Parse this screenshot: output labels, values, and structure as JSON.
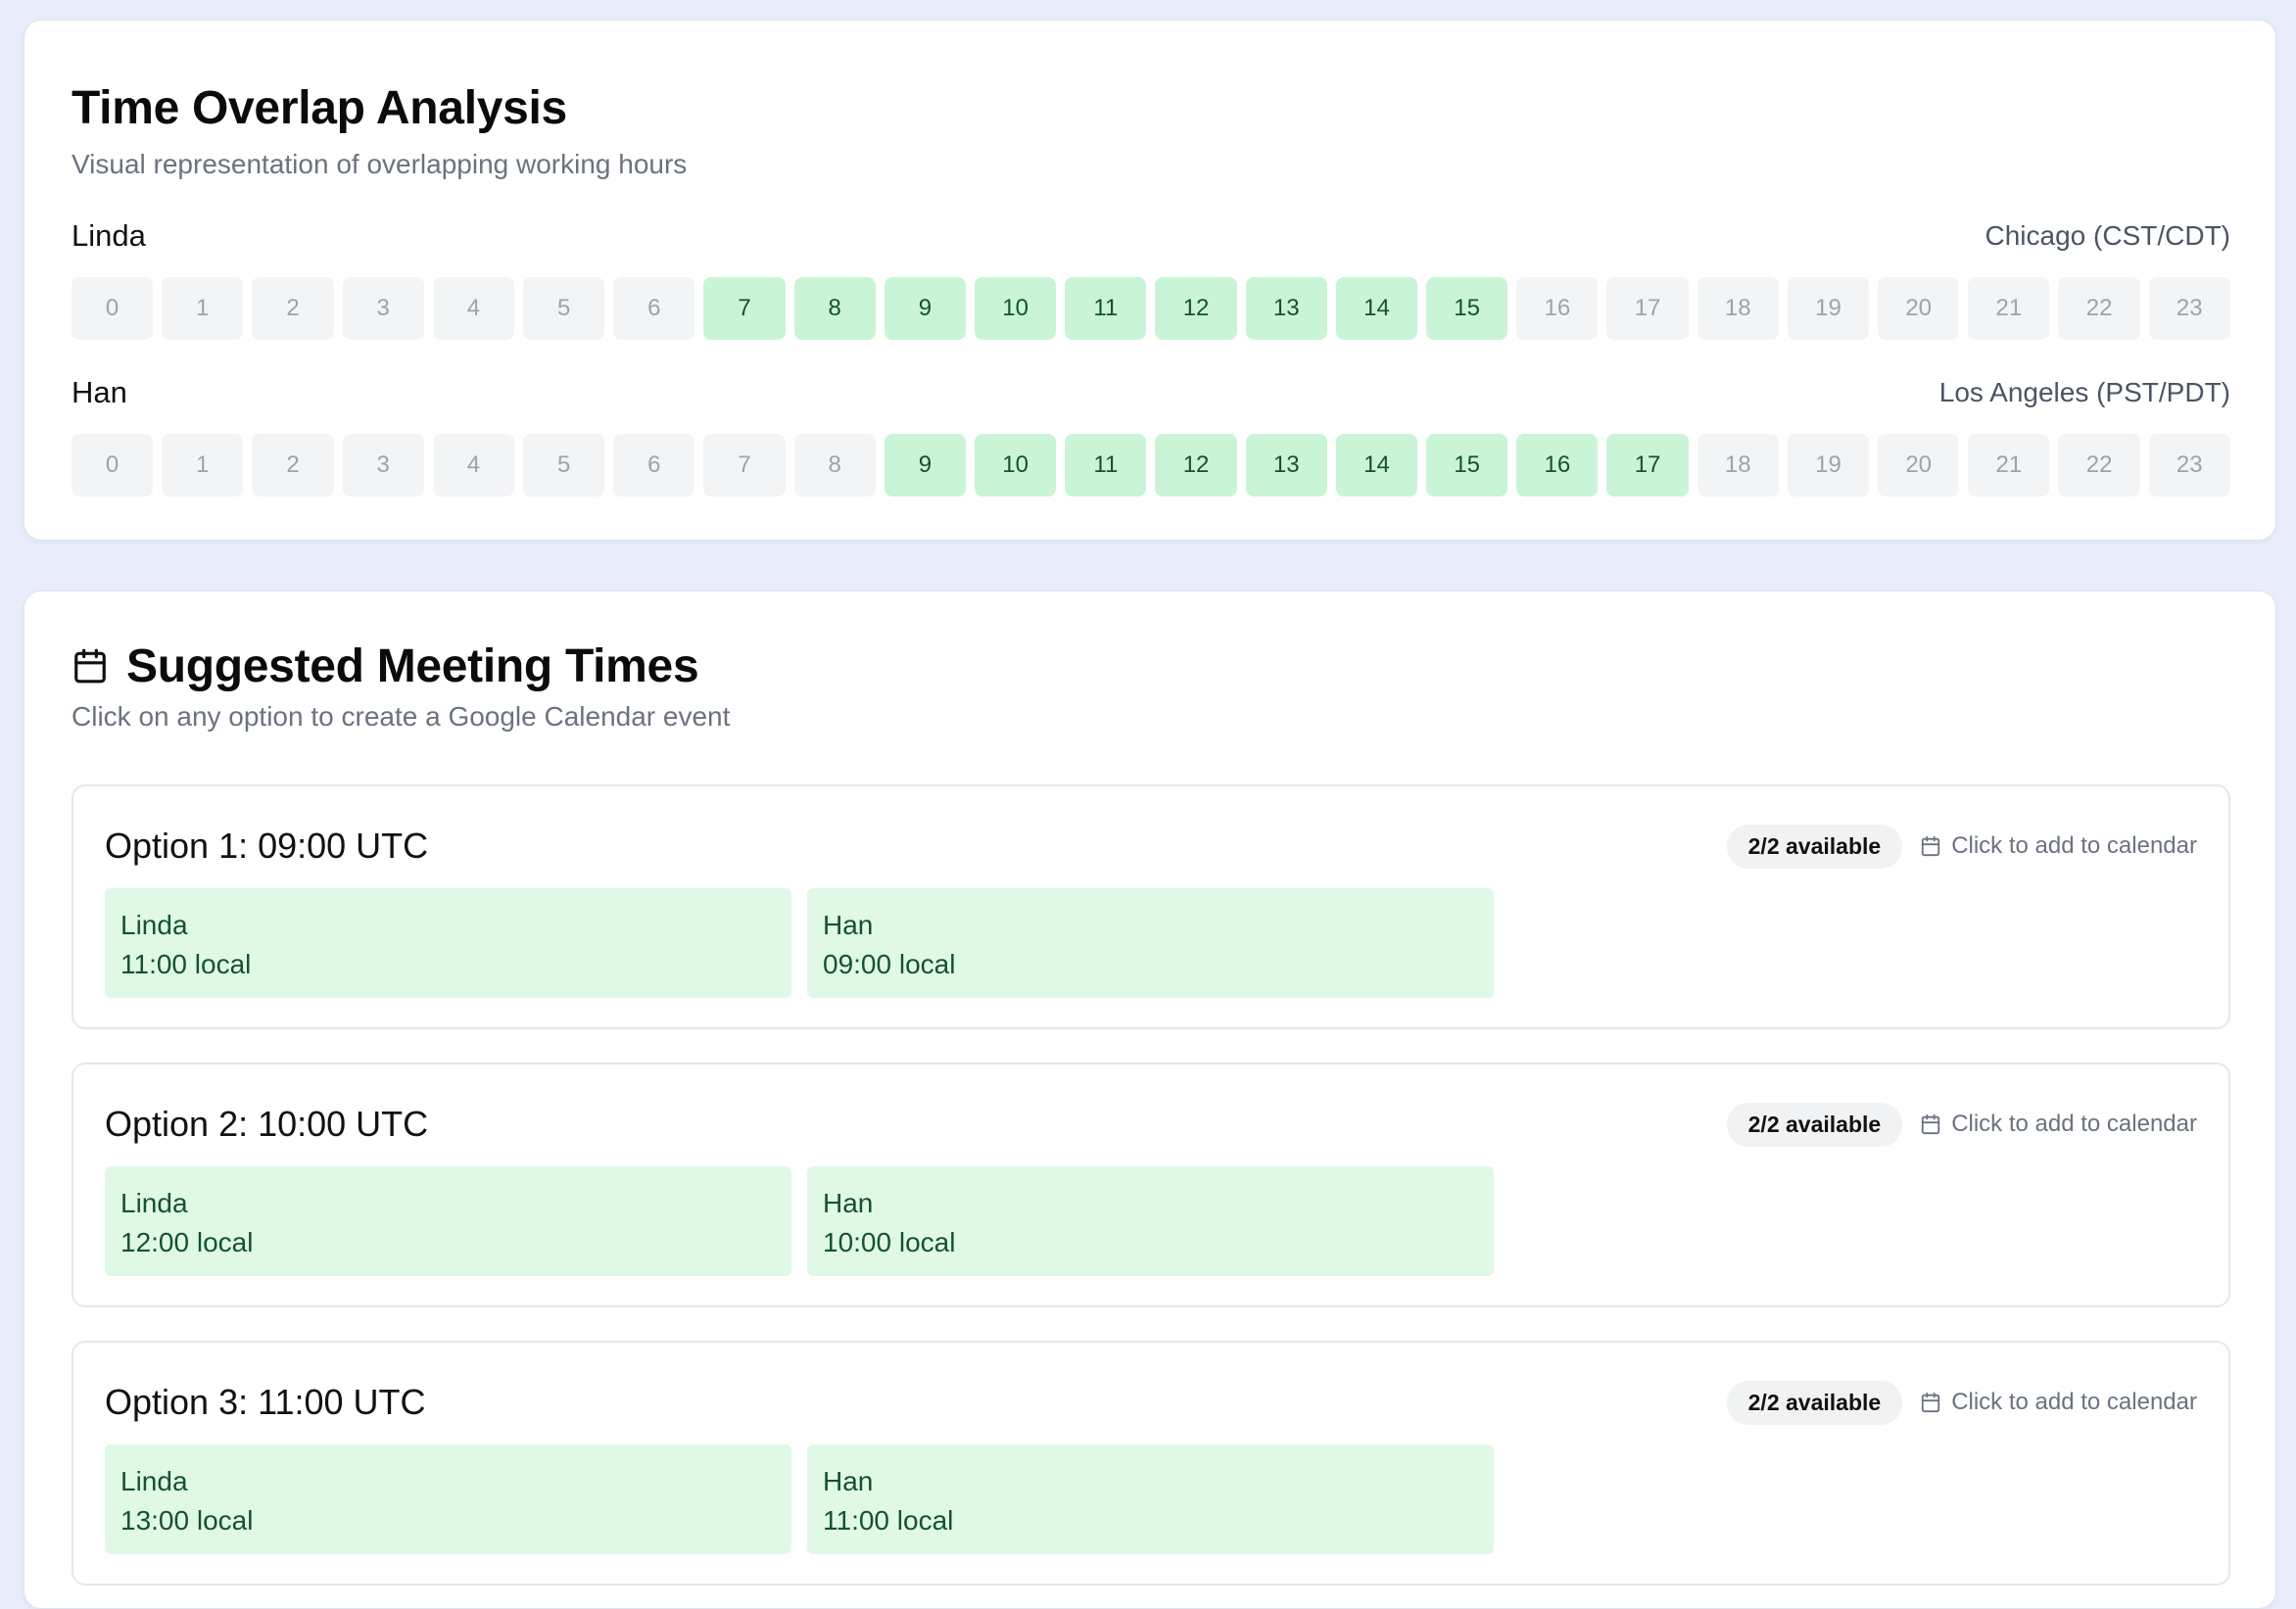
{
  "overlap": {
    "title": "Time Overlap Analysis",
    "subtitle": "Visual representation of overlapping working hours",
    "people": [
      {
        "name": "Linda",
        "timezone": "Chicago (CST/CDT)",
        "active_hours": [
          7,
          8,
          9,
          10,
          11,
          12,
          13,
          14,
          15
        ]
      },
      {
        "name": "Han",
        "timezone": "Los Angeles (PST/PDT)",
        "active_hours": [
          9,
          10,
          11,
          12,
          13,
          14,
          15,
          16,
          17
        ]
      }
    ],
    "hour_labels": [
      "0",
      "1",
      "2",
      "3",
      "4",
      "5",
      "6",
      "7",
      "8",
      "9",
      "10",
      "11",
      "12",
      "13",
      "14",
      "15",
      "16",
      "17",
      "18",
      "19",
      "20",
      "21",
      "22",
      "23"
    ],
    "colors": {
      "active_bg": "#c9f5d6",
      "inactive_bg": "#f3f4f6"
    }
  },
  "meetings": {
    "title": "Suggested Meeting Times",
    "subtitle": "Click on any option to create a Google Calendar event",
    "icon": "calendar-icon",
    "options": [
      {
        "title": "Option 1: 09:00 UTC",
        "badge": "2/2 available",
        "add_label": "Click to add to calendar",
        "slots": [
          {
            "name": "Linda",
            "time": "11:00 local"
          },
          {
            "name": "Han",
            "time": "09:00 local"
          }
        ]
      },
      {
        "title": "Option 2: 10:00 UTC",
        "badge": "2/2 available",
        "add_label": "Click to add to calendar",
        "slots": [
          {
            "name": "Linda",
            "time": "12:00 local"
          },
          {
            "name": "Han",
            "time": "10:00 local"
          }
        ]
      },
      {
        "title": "Option 3: 11:00 UTC",
        "badge": "2/2 available",
        "add_label": "Click to add to calendar",
        "slots": [
          {
            "name": "Linda",
            "time": "13:00 local"
          },
          {
            "name": "Han",
            "time": "11:00 local"
          }
        ]
      }
    ]
  }
}
